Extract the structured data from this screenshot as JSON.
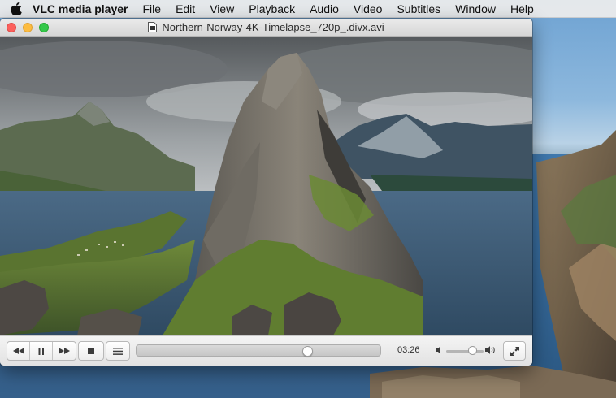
{
  "menubar": {
    "apple_icon": "apple-icon",
    "app_name": "VLC media player",
    "items": [
      "File",
      "Edit",
      "View",
      "Playback",
      "Audio",
      "Video",
      "Subtitles",
      "Window",
      "Help"
    ]
  },
  "window": {
    "title": "Northern-Norway-4K-Timelapse_720p_.divx.avi",
    "file_icon": "video-file-icon"
  },
  "controls": {
    "previous_icon": "rewind-icon",
    "play_pause_icon": "pause-icon",
    "next_icon": "fast-forward-icon",
    "stop_icon": "stop-icon",
    "playlist_icon": "playlist-icon",
    "fullscreen_icon": "fullscreen-icon",
    "time_remaining": "03:26",
    "seek_progress": 0.7,
    "volume_level": 0.7,
    "volume_low_icon": "speaker-low-icon",
    "volume_high_icon": "speaker-high-icon"
  },
  "colors": {
    "close": "#fc605c",
    "minimize": "#fdbc40",
    "maximize": "#34c84a"
  }
}
